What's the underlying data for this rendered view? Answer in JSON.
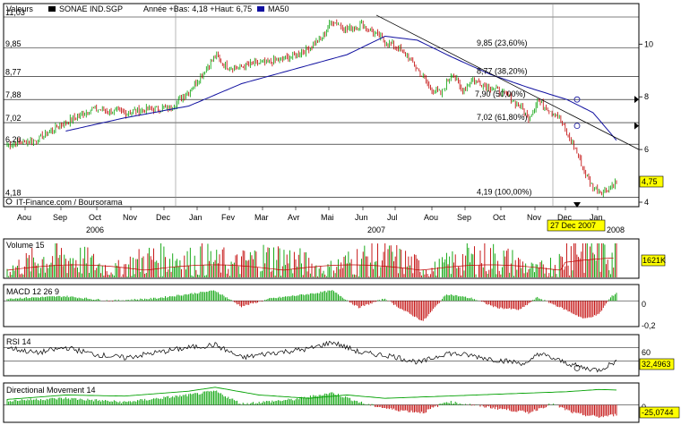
{
  "header": {
    "label_valeurs": "Valeurs",
    "symbol": "SONAE IND.SGP",
    "info": "Année +Bas: 4,18 +Haut: 6,75",
    "ma_label": "MA50",
    "credit": "IT-Finance.com / Boursorama"
  },
  "colors": {
    "up": "#00a000",
    "down": "#c00000",
    "ma": "#1010a0",
    "grid": "#000000",
    "highlight": "#ffff00",
    "rsi": "#000000",
    "dm": "#00a000"
  },
  "chart_data": [
    {
      "type": "candlestick",
      "name": "main",
      "y_ticks_left": [
        "11,03",
        "9,85",
        "8,77",
        "7,88",
        "7,02",
        "6,20",
        "4,18"
      ],
      "y_ticks_right": [
        "10",
        "8",
        "6",
        "4"
      ],
      "months": [
        "Aou",
        "Sep",
        "Oct",
        "Nov",
        "Dec",
        "Jan",
        "Fev",
        "Mar",
        "Avr",
        "Mai",
        "Jun",
        "Jul",
        "Aou",
        "Sep",
        "Oct",
        "Nov",
        "Dec",
        "Jan"
      ],
      "years": [
        "2006",
        "2007",
        "2008"
      ],
      "fib_levels": [
        {
          "value": 9.85,
          "label": "9,85 (23,60%)"
        },
        {
          "value": 8.77,
          "label": "8,77 (38,20%)"
        },
        {
          "value": 7.9,
          "label": "7,90 (50,00%)"
        },
        {
          "value": 7.02,
          "label": "7,02 (61,80%)"
        },
        {
          "value": 4.19,
          "label": "4,19 (100,00%)"
        }
      ],
      "last_value": "4,75",
      "cursor_date": "27 Dec 2007",
      "ylim": [
        4.0,
        11.2
      ],
      "keypoints": [
        [
          0,
          6.2
        ],
        [
          20,
          6.35
        ],
        [
          35,
          6.9
        ],
        [
          48,
          7.25
        ],
        [
          58,
          7.55
        ],
        [
          70,
          7.45
        ],
        [
          80,
          7.4
        ],
        [
          92,
          7.5
        ],
        [
          104,
          7.55
        ],
        [
          112,
          7.6
        ],
        [
          124,
          8.2
        ],
        [
          132,
          8.8
        ],
        [
          142,
          9.55
        ],
        [
          150,
          9.15
        ],
        [
          158,
          9.1
        ],
        [
          168,
          9.25
        ],
        [
          178,
          9.3
        ],
        [
          186,
          9.4
        ],
        [
          196,
          9.55
        ],
        [
          206,
          9.85
        ],
        [
          214,
          10.2
        ],
        [
          222,
          10.9
        ],
        [
          232,
          10.55
        ],
        [
          242,
          10.75
        ],
        [
          250,
          10.45
        ],
        [
          258,
          10.1
        ],
        [
          266,
          9.9
        ],
        [
          274,
          9.5
        ],
        [
          280,
          9.05
        ],
        [
          288,
          8.4
        ],
        [
          296,
          8.1
        ],
        [
          304,
          8.95
        ],
        [
          310,
          8.25
        ],
        [
          318,
          8.65
        ],
        [
          326,
          8.45
        ],
        [
          334,
          8.25
        ],
        [
          342,
          8.0
        ],
        [
          350,
          7.65
        ],
        [
          356,
          7.2
        ],
        [
          362,
          7.85
        ],
        [
          368,
          7.6
        ],
        [
          376,
          7.3
        ],
        [
          382,
          6.6
        ],
        [
          388,
          6.0
        ],
        [
          394,
          5.2
        ],
        [
          400,
          4.55
        ],
        [
          406,
          4.4
        ],
        [
          412,
          4.6
        ],
        [
          416,
          4.75
        ]
      ],
      "ma50_keypoints": [
        [
          40,
          6.7
        ],
        [
          80,
          7.2
        ],
        [
          124,
          7.65
        ],
        [
          160,
          8.5
        ],
        [
          196,
          9.05
        ],
        [
          232,
          9.6
        ],
        [
          258,
          10.3
        ],
        [
          280,
          10.15
        ],
        [
          304,
          9.5
        ],
        [
          330,
          8.85
        ],
        [
          356,
          8.35
        ],
        [
          382,
          7.9
        ],
        [
          400,
          7.4
        ],
        [
          416,
          6.35
        ]
      ],
      "trend_points": [
        [
          248,
          11.1
        ],
        [
          416,
          6.0
        ]
      ]
    },
    {
      "type": "bar",
      "name": "Volume 15",
      "last_value": "1621K"
    },
    {
      "type": "bar",
      "name": "MACD 12 26 9",
      "y_ticks": [
        "0",
        "-0,2"
      ],
      "keypoints": [
        [
          0,
          0.02
        ],
        [
          40,
          0.04
        ],
        [
          70,
          0.0
        ],
        [
          100,
          0.02
        ],
        [
          124,
          0.06
        ],
        [
          142,
          0.09
        ],
        [
          160,
          -0.05
        ],
        [
          180,
          0.02
        ],
        [
          206,
          0.06
        ],
        [
          222,
          0.09
        ],
        [
          240,
          -0.06
        ],
        [
          258,
          0.02
        ],
        [
          270,
          -0.08
        ],
        [
          284,
          -0.18
        ],
        [
          300,
          0.06
        ],
        [
          318,
          0.02
        ],
        [
          334,
          -0.06
        ],
        [
          350,
          -0.08
        ],
        [
          362,
          0.03
        ],
        [
          378,
          -0.06
        ],
        [
          394,
          -0.16
        ],
        [
          404,
          -0.12
        ],
        [
          412,
          0.03
        ],
        [
          416,
          0.07
        ]
      ],
      "ylim": [
        -0.22,
        0.12
      ]
    },
    {
      "type": "line",
      "name": "RSI 14",
      "y_ticks": [
        "60"
      ],
      "last_value": "32,4963",
      "keypoints": [
        [
          0,
          60
        ],
        [
          20,
          52
        ],
        [
          40,
          60
        ],
        [
          60,
          50
        ],
        [
          80,
          45
        ],
        [
          100,
          52
        ],
        [
          124,
          60
        ],
        [
          142,
          64
        ],
        [
          160,
          45
        ],
        [
          180,
          52
        ],
        [
          206,
          58
        ],
        [
          222,
          68
        ],
        [
          242,
          52
        ],
        [
          262,
          48
        ],
        [
          282,
          38
        ],
        [
          300,
          52
        ],
        [
          318,
          48
        ],
        [
          334,
          42
        ],
        [
          356,
          36
        ],
        [
          362,
          52
        ],
        [
          378,
          40
        ],
        [
          394,
          30
        ],
        [
          404,
          27
        ],
        [
          412,
          36
        ],
        [
          416,
          40
        ]
      ],
      "ylim": [
        20,
        75
      ]
    },
    {
      "type": "bar",
      "name": "Directional Movement 14",
      "y_ticks": [
        "0"
      ],
      "last_value": "-25,0744",
      "adx_keypoints": [
        [
          0,
          10
        ],
        [
          40,
          18
        ],
        [
          80,
          16
        ],
        [
          124,
          25
        ],
        [
          142,
          32
        ],
        [
          172,
          18
        ],
        [
          206,
          12
        ],
        [
          232,
          18
        ],
        [
          258,
          12
        ],
        [
          300,
          16
        ],
        [
          340,
          20
        ],
        [
          382,
          24
        ],
        [
          404,
          28
        ],
        [
          416,
          27
        ]
      ],
      "dm_keypoints": [
        [
          0,
          8
        ],
        [
          40,
          12
        ],
        [
          80,
          5
        ],
        [
          124,
          18
        ],
        [
          142,
          25
        ],
        [
          160,
          2
        ],
        [
          196,
          10
        ],
        [
          222,
          22
        ],
        [
          244,
          2
        ],
        [
          262,
          -8
        ],
        [
          284,
          -14
        ],
        [
          300,
          6
        ],
        [
          334,
          -6
        ],
        [
          356,
          -14
        ],
        [
          372,
          2
        ],
        [
          388,
          -16
        ],
        [
          404,
          -22
        ],
        [
          416,
          -18
        ]
      ],
      "ylim": [
        -30,
        35
      ]
    }
  ]
}
